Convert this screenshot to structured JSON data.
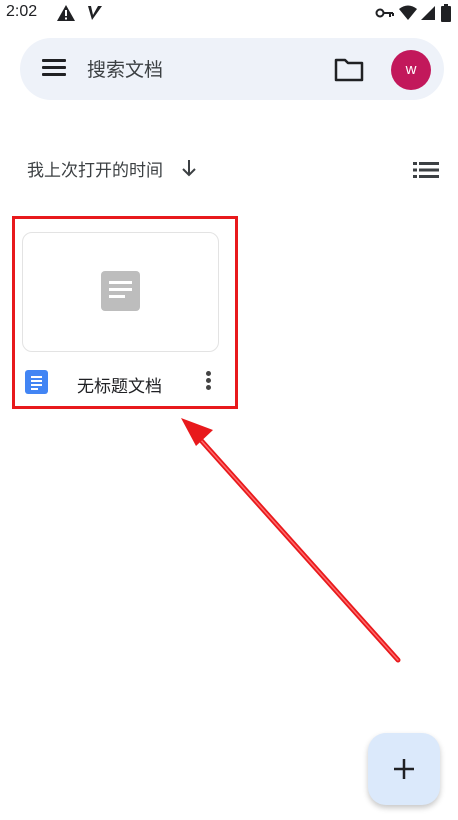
{
  "status_bar": {
    "time": "2:02",
    "left_icons": [
      "warning-icon",
      "v-icon"
    ],
    "right_icons": [
      "key-icon",
      "wifi-icon",
      "signal-icon",
      "battery-icon"
    ]
  },
  "search": {
    "placeholder": "搜索文档",
    "avatar_letter": "w",
    "avatar_color": "#c2185b"
  },
  "sort": {
    "label": "我上次打开的时间"
  },
  "documents": [
    {
      "title": "无标题文档"
    }
  ],
  "colors": {
    "accent_blue": "#4285f4",
    "highlight_red": "#e8191c",
    "fab_bg": "#dbe9fb"
  }
}
